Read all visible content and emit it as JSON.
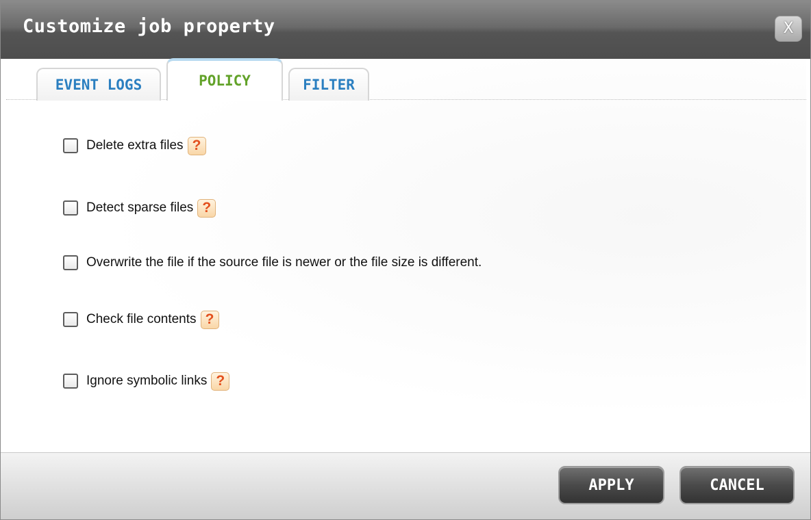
{
  "window": {
    "title": "Customize job property",
    "close_symbol": "X"
  },
  "tabs": [
    {
      "label": "EVENT LOGS",
      "active": false
    },
    {
      "label": "POLICY",
      "active": true
    },
    {
      "label": "FILTER",
      "active": false
    }
  ],
  "options": [
    {
      "label": "Delete extra files",
      "checked": false,
      "has_help": true
    },
    {
      "label": "Detect sparse files",
      "checked": false,
      "has_help": true
    },
    {
      "label": "Overwrite the file if the source file is newer or the file size is different.",
      "checked": false,
      "has_help": false
    },
    {
      "label": "Check file contents",
      "checked": false,
      "has_help": true
    },
    {
      "label": "Ignore symbolic links",
      "checked": false,
      "has_help": true
    }
  ],
  "help_glyph": "?",
  "buttons": {
    "apply": "APPLY",
    "cancel": "CANCEL"
  },
  "colors": {
    "active_tab": "#62a229",
    "inactive_tab": "#2b7fc0",
    "help_mark": "#e3501e",
    "titlebar": "#5a5a5a"
  },
  "icons": {
    "close": "close-icon",
    "help": "help-icon",
    "checkbox": "checkbox-unchecked"
  }
}
